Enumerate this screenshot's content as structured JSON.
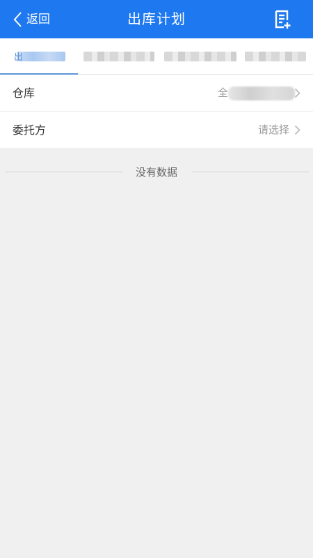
{
  "header": {
    "back_label": "返回",
    "title": "出库计划",
    "doc_icon": "document-add-icon",
    "background_color": "#1e78f0"
  },
  "tabs": [
    {
      "label_visible": "出",
      "active": true,
      "accent_color": "#5b95d8"
    },
    {
      "redacted": true
    },
    {
      "redacted": true
    },
    {
      "redacted": true
    }
  ],
  "form": {
    "rows": [
      {
        "label": "仓库",
        "value_visible": "全",
        "value_redacted": true
      },
      {
        "label": "委托方",
        "value": "请选择"
      }
    ]
  },
  "empty_state": {
    "text": "没有数据"
  }
}
